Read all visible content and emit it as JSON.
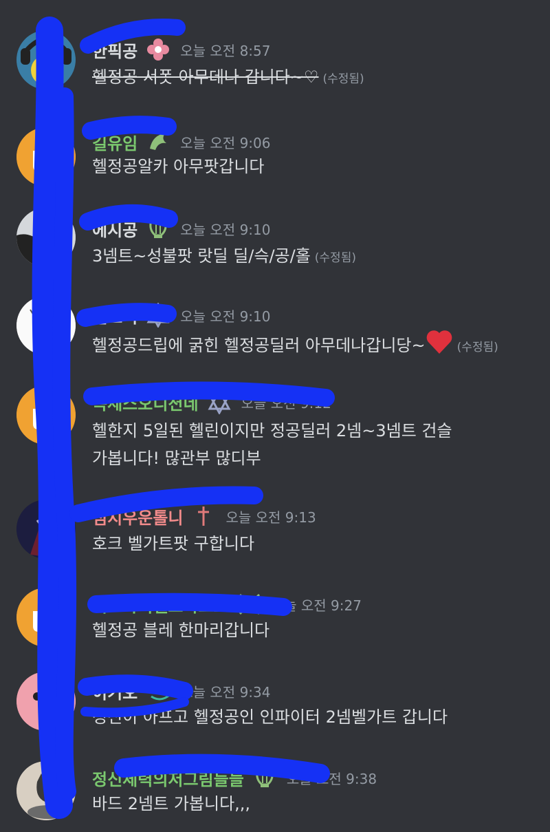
{
  "messages": [
    {
      "username": "한픽공",
      "name_color": "#f2f3f5",
      "time": "오늘 오전 8:57",
      "text": "헬정공 서폿 아무데나 갑니다~♡",
      "edited": "(수정됨)",
      "strike": true
    },
    {
      "username": "길유임",
      "name_color": "#7bc96f",
      "time": "오늘 오전 9:06",
      "text": "헬정공알카 아무팟갑니다",
      "edited": ""
    },
    {
      "username": "에시공",
      "name_color": "#f2f3f5",
      "time": "오늘 오전 9:10",
      "text": "3넴트~성불팟 랏딜 딜/슥/공/홀",
      "edited": "(수정됨)"
    },
    {
      "username": "설소익",
      "name_color": "#f2f3f5",
      "time": "오늘 오전 9:10",
      "text": "헬정공드립에 굵힌 헬정공딜러 아무데나갑니당~",
      "edited": "(수정됨)"
    },
    {
      "username": "녹세스오디션네",
      "name_color": "#7bc96f",
      "time": "오늘 오전 9:12",
      "text": "헬한지 5일된 헬린이지만 정공딜러 2넴~3넴트 건슬",
      "text2": "가봅니다! 많관부 많디부",
      "edited": ""
    },
    {
      "username": "점지우운톨니",
      "name_color": "#f28b8b",
      "time": "오늘 오전 9:13",
      "text": "호크 벨가트팟 구합니다",
      "edited": ""
    },
    {
      "username": "이드아이헬크바스트",
      "name_color": "#7bc96f",
      "time": "오늘 오전 9:27",
      "text": "헬정공 블레 한마리갑니다",
      "edited": ""
    },
    {
      "username": "이기오",
      "name_color": "#f2f3f5",
      "time": "오늘 오전 9:34",
      "text": "정신이 아프고 헬정공인 인파이터 2넴벨가트 갑니다",
      "edited": ""
    },
    {
      "username": "정신체력의저그림들늘",
      "name_color": "#7bc96f",
      "time": "오늘 오전 9:38",
      "text": "바드 2넴트 가봅니다,,,",
      "edited": ""
    }
  ]
}
